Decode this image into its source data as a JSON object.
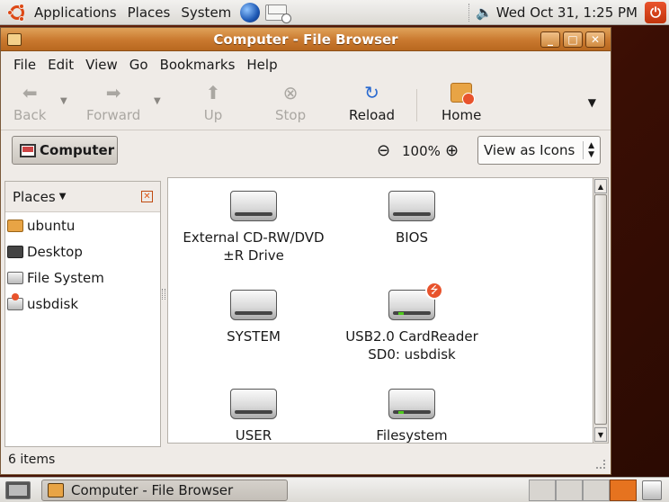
{
  "top_panel": {
    "menus": [
      "Applications",
      "Places",
      "System"
    ],
    "clock": "Wed Oct 31,  1:25 PM"
  },
  "window": {
    "title": "Computer - File Browser",
    "menubar": [
      "File",
      "Edit",
      "View",
      "Go",
      "Bookmarks",
      "Help"
    ],
    "toolbar": {
      "back": "Back",
      "forward": "Forward",
      "up": "Up",
      "stop": "Stop",
      "reload": "Reload",
      "home": "Home"
    },
    "location": {
      "button": "Computer",
      "zoom": "100%",
      "view_mode": "View as Icons"
    },
    "sidepane": {
      "title": "Places",
      "items": [
        "ubuntu",
        "Desktop",
        "File System",
        "usbdisk"
      ]
    },
    "icons": [
      {
        "line1": "External CD-RW/DVD",
        "line2": "±R Drive"
      },
      {
        "line1": "BIOS",
        "line2": ""
      },
      {
        "line1": "SYSTEM",
        "line2": ""
      },
      {
        "line1": "USB2.0 CardReader",
        "line2": "SD0: usbdisk"
      },
      {
        "line1": "USER",
        "line2": ""
      },
      {
        "line1": "Filesystem",
        "line2": ""
      }
    ],
    "status": "6 items"
  },
  "bottom_panel": {
    "task": "Computer - File Browser"
  }
}
